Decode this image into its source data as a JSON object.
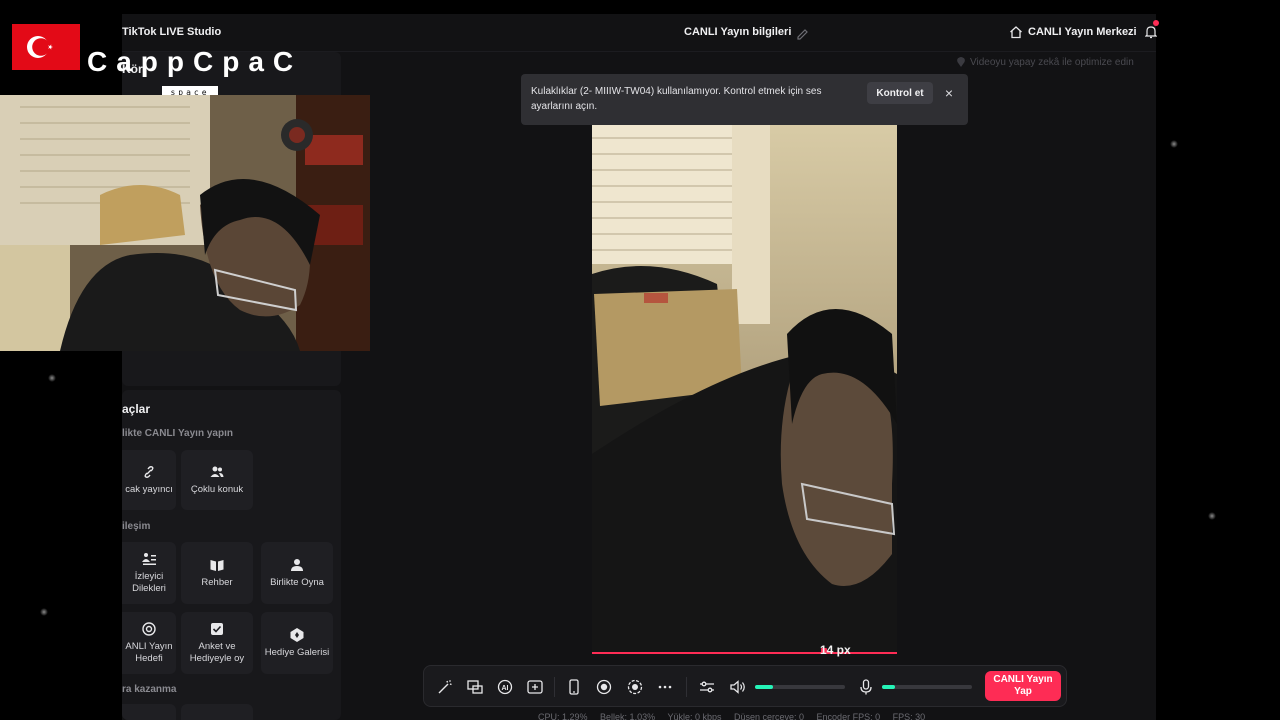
{
  "app": {
    "title": "TikTok LIVE Studio",
    "info_title": "CANLI Yayın bilgileri",
    "center_label": "CANLI Yayın Merkezi",
    "optimize_text": "Videoyu yapay zekâ ile optimize edin",
    "panel_top_title": "Kör"
  },
  "notification": {
    "message": "Kulaklıklar (2- MIIIW-TW04) kullanılamıyor. Kontrol etmek için ses ayarlarını açın.",
    "action_label": "Kontrol et",
    "close_glyph": "×"
  },
  "tools": {
    "title": "açlar",
    "sections": [
      {
        "label": "likte CANLI Yayın yapın"
      },
      {
        "label": "ileşim"
      },
      {
        "label": "ra kazanma"
      }
    ],
    "tiles": [
      {
        "label": "cak yayıncı",
        "icon": "link-icon"
      },
      {
        "label": "Çoklu konuk",
        "icon": "users-icon"
      },
      {
        "label": "İzleyici Dilekleri",
        "icon": "people-list-icon"
      },
      {
        "label": "Rehber",
        "icon": "book-icon"
      },
      {
        "label": "Birlikte Oyna",
        "icon": "player-icon"
      },
      {
        "label": "ANLI Yayın Hedefi",
        "icon": "target-icon"
      },
      {
        "label": "Anket ve Hediyeyle oy",
        "icon": "poll-icon"
      },
      {
        "label": "Hediye Galerisi",
        "icon": "gift-gallery-icon"
      }
    ]
  },
  "preview": {
    "px_label": "14 px"
  },
  "toolbar": {
    "live_label": "CANLI Yayın Yap",
    "volume_level": 0.2,
    "mic_level": 0.14
  },
  "stats": {
    "cpu": "CPU: 1.29%",
    "memory": "Bellek: 1.03%",
    "upload": "Yükle: 0 kbps",
    "dropped": "Düşen çerçeve: 0",
    "encoder_fps": "Encoder FPS: 0",
    "fps": "FPS: 30"
  },
  "overlay": {
    "channel_name": "CappCpaC",
    "channel_sub": "space"
  },
  "colors": {
    "accent": "#fe2c55",
    "slider": "#25f4b7",
    "flag_red": "#e30a17"
  }
}
